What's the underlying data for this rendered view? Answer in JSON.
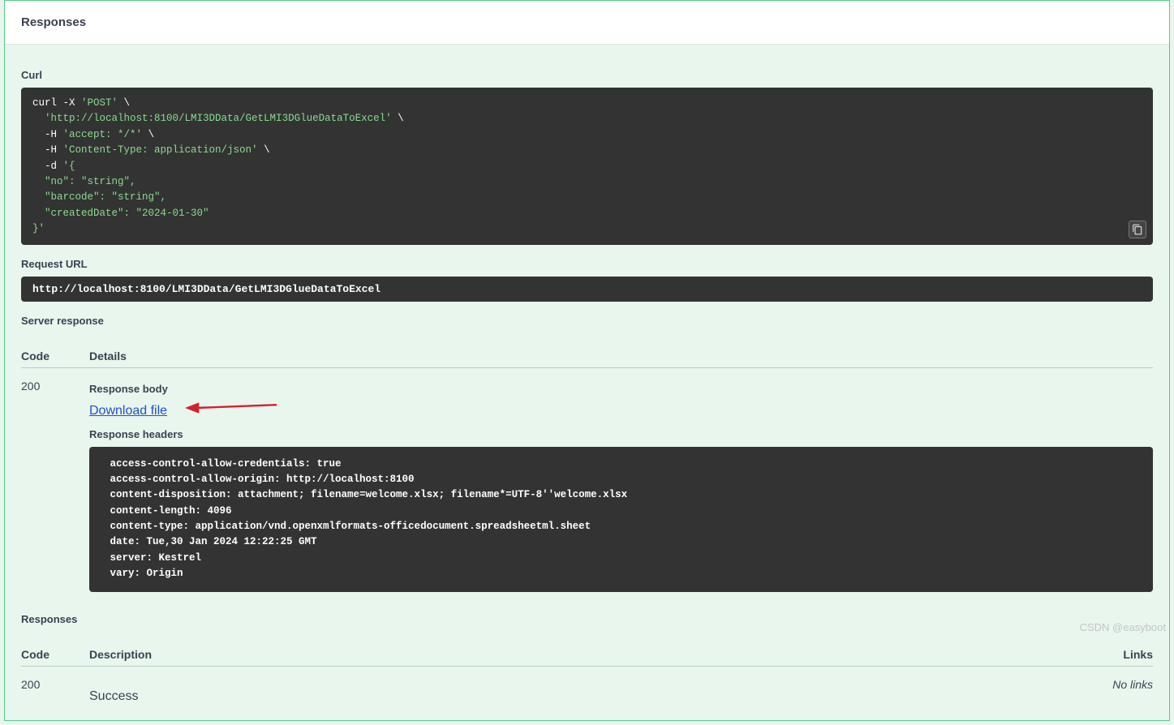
{
  "section_title": "Responses",
  "curl": {
    "label": "Curl",
    "line1a": "curl -X ",
    "line1b": "'POST'",
    "line1c": " \\",
    "line2a": "  ",
    "line2b": "'http://localhost:8100/LMI3DData/GetLMI3DGlueDataToExcel'",
    "line2c": " \\",
    "line3a": "  -H ",
    "line3b": "'accept: */*'",
    "line3c": " \\",
    "line4a": "  -H ",
    "line4b": "'Content-Type: application/json'",
    "line4c": " \\",
    "line5a": "  -d ",
    "line5b": "'{",
    "line6": "  \"no\": \"string\",",
    "line7": "  \"barcode\": \"string\",",
    "line8": "  \"createdDate\": \"2024-01-30\"",
    "line9": "}'"
  },
  "request_url": {
    "label": "Request URL",
    "value": "http://localhost:8100/LMI3DData/GetLMI3DGlueDataToExcel"
  },
  "server_response_label": "Server response",
  "headers": {
    "code": "Code",
    "details": "Details",
    "description": "Description",
    "links": "Links"
  },
  "response1": {
    "code": "200",
    "body_label": "Response body",
    "download_label": "Download file",
    "headers_label": "Response headers",
    "headers_block": " access-control-allow-credentials: true \n access-control-allow-origin: http://localhost:8100 \n content-disposition: attachment; filename=welcome.xlsx; filename*=UTF-8''welcome.xlsx \n content-length: 4096 \n content-type: application/vnd.openxmlformats-officedocument.spreadsheetml.sheet \n date: Tue,30 Jan 2024 12:22:25 GMT \n server: Kestrel \n vary: Origin "
  },
  "responses_label": "Responses",
  "response2": {
    "code": "200",
    "description": "Success",
    "no_links": "No links"
  },
  "watermark": "CSDN @easyboot"
}
